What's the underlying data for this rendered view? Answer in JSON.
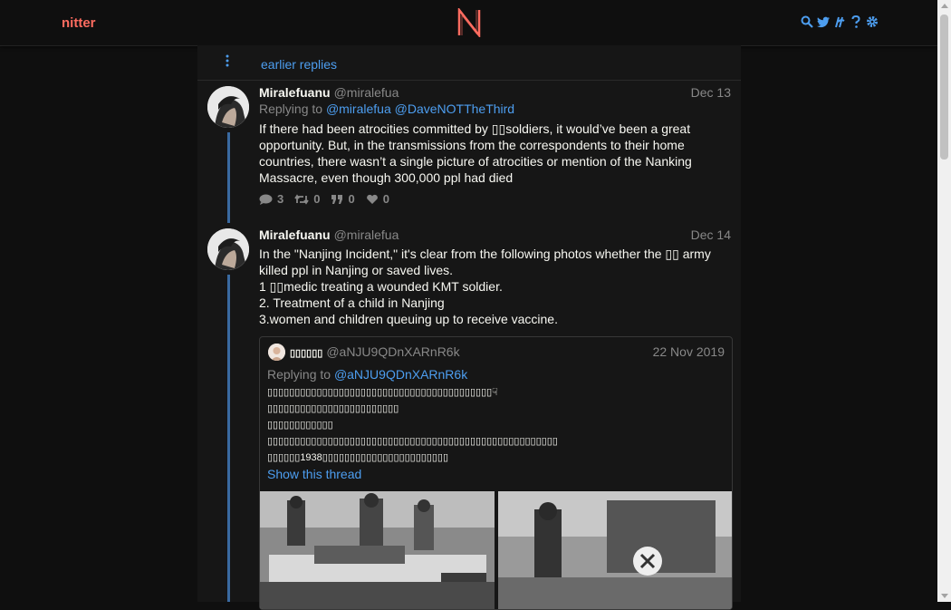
{
  "nav": {
    "brand": "nitter",
    "icons": [
      "search-icon",
      "twitter-icon",
      "rss-icon",
      "help-icon",
      "settings-icon"
    ]
  },
  "colors": {
    "accent": "#ff6c60",
    "link": "#4d9ef0",
    "thread": "#3a6aa0",
    "bg": "#0f0f0f",
    "panel": "#161616"
  },
  "timeline": {
    "earlier_replies": "earlier replies",
    "tweets": [
      {
        "fullname": "Miralefuanu",
        "username": "@miralefua",
        "date": "Dec 13",
        "replying_prefix": "Replying to",
        "replying_to": [
          "@miralefua",
          "@DaveNOTTheThird"
        ],
        "content": "If there had been atrocities committed by ▯▯soldiers, it would’ve been a great opportunity. But, in the transmissions from the correspondents to their home countries, there wasn’t a single picture of atrocities or mention of the Nanking Massacre, even though 300,000 ppl had died",
        "stats": {
          "replies": "3",
          "retweets": "0",
          "quotes": "0",
          "likes": "0"
        }
      },
      {
        "fullname": "Miralefuanu",
        "username": "@miralefua",
        "date": "Dec 14",
        "content": "In the \"Nanjing Incident,\" it's clear from the following photos whether the ▯▯ army killed ppl in Nanjing or saved lives.\n1 ▯▯medic treating a wounded KMT soldier.\n2. Treatment of a child in Nanjing\n3.women and children queuing up to receive vaccine.",
        "quote": {
          "fullname": "▯▯▯▯▯▯",
          "username": "@aNJU9QDnXARnR6k",
          "date": "22 Nov 2019",
          "replying_prefix": "Replying to",
          "replying_to": "@aNJU9QDnXARnR6k",
          "content": "▯▯▯▯▯▯▯▯▯▯▯▯▯▯▯▯▯▯▯▯▯▯▯▯▯▯▯▯▯▯▯▯▯▯▯▯▯▯▯▯▯☟\n▯▯▯▯▯▯▯▯▯▯▯▯▯▯▯▯▯▯▯▯▯▯▯▯\n▯▯▯▯▯▯▯▯▯▯▯▯\n▯▯▯▯▯▯▯▯▯▯▯▯▯▯▯▯▯▯▯▯▯▯▯▯▯▯▯▯▯▯▯▯▯▯▯▯▯▯▯▯▯▯▯▯▯▯▯▯▯▯▯▯▯\n▯▯▯▯▯▯1938▯▯▯▯▯▯▯▯▯▯▯▯▯▯▯▯▯▯▯▯▯▯▯",
          "show_thread": "Show this thread"
        }
      }
    ]
  }
}
